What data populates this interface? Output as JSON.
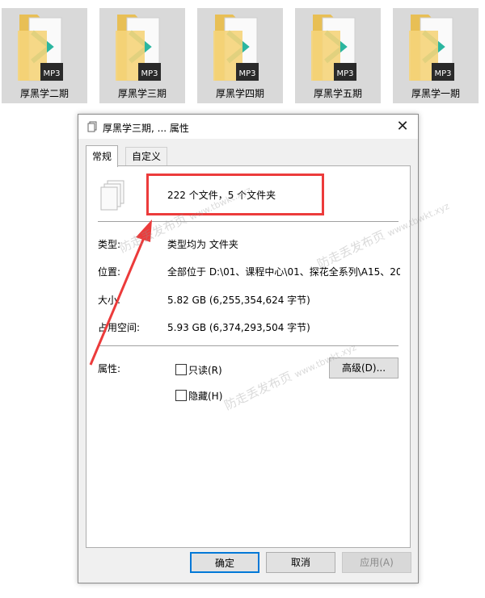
{
  "folders": [
    {
      "label": "厚黑学二期"
    },
    {
      "label": "厚黑学三期"
    },
    {
      "label": "厚黑学四期"
    },
    {
      "label": "厚黑学五期"
    },
    {
      "label": "厚黑学一期"
    }
  ],
  "folder_badge": "MP3",
  "dialog": {
    "title": "厚黑学三期, ... 属性",
    "close": "✕",
    "tabs": [
      {
        "label": "常规",
        "active": true
      },
      {
        "label": "自定义",
        "active": false
      }
    ],
    "summary": "222 个文件，5 个文件夹",
    "rows": [
      {
        "label": "类型:",
        "value": "类型均为 文件夹"
      },
      {
        "label": "位置:",
        "value": "全部位于 D:\\01、课程中心\\01、探花全系列\\A15、20"
      },
      {
        "label": "大小:",
        "value": "5.82 GB (6,255,354,624 字节)"
      },
      {
        "label": "占用空间:",
        "value": "5.93 GB (6,374,293,504 字节)"
      }
    ],
    "attributes_label": "属性:",
    "readonly_label": "只读(R)",
    "hidden_label": "隐藏(H)",
    "advanced_button": "高级(D)...",
    "ok_button": "确定",
    "cancel_button": "取消",
    "apply_button": "应用(A)"
  },
  "watermark": {
    "text": "防走丢发布页",
    "url": "www.tbwkt.xyz"
  },
  "colors": {
    "highlight": "#ec3b3b",
    "accent": "#0078d7",
    "folder": "#f5d47a",
    "arrow": "#ec3b3b"
  }
}
